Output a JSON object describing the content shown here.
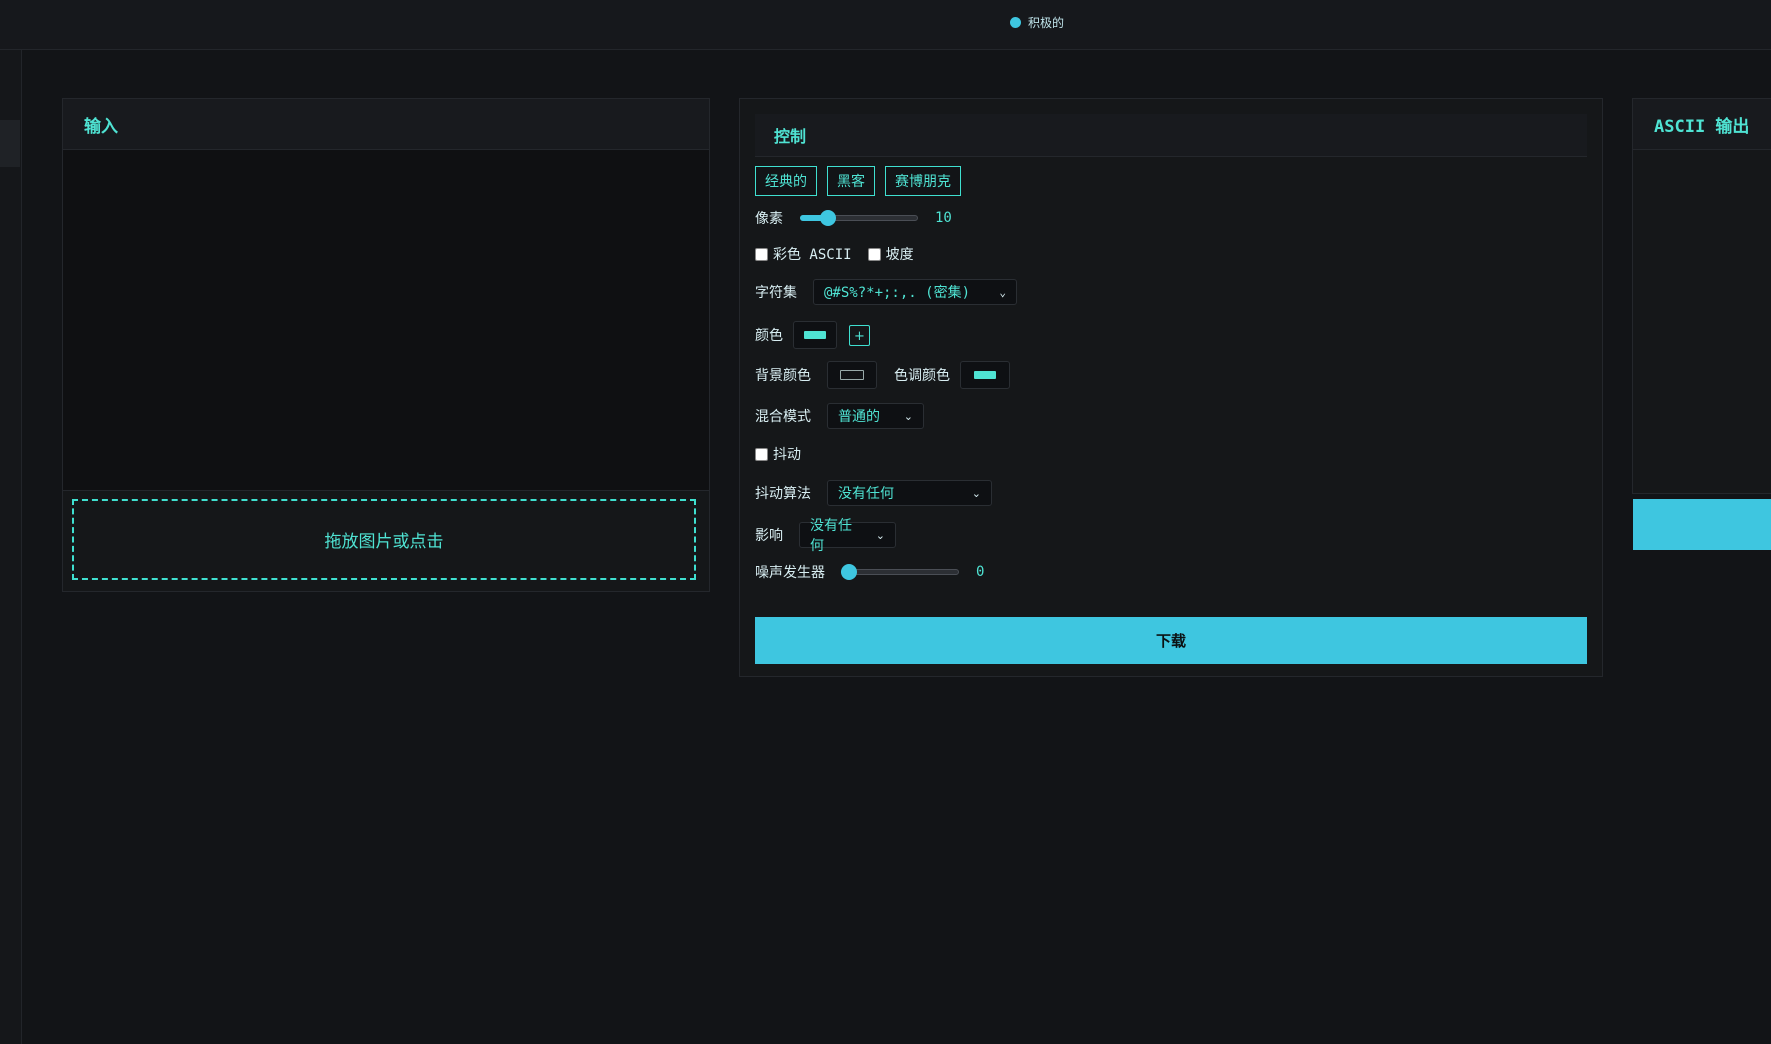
{
  "status": {
    "label": "积极的",
    "dot_color": "#3ec6e0"
  },
  "input_panel": {
    "title": "输入",
    "dropzone_label": "拖放图片或点击"
  },
  "controls": {
    "title": "控制",
    "presets": [
      "经典的",
      "黑客",
      "赛博朋克"
    ],
    "pixel": {
      "label": "像素",
      "value": "10",
      "fraction": 0.24
    },
    "color_ascii_label": "彩色 ASCII",
    "gradient_label": "坡度",
    "charset": {
      "label": "字符集",
      "value": "@#S%?*+;:,. (密集)"
    },
    "color": {
      "label": "颜色",
      "swatch": "#4fe3d3",
      "add": "+"
    },
    "bg_color": {
      "label": "背景颜色",
      "swatch": "#121417"
    },
    "tint_color": {
      "label": "色调颜色",
      "swatch": "#4fe3d3"
    },
    "blend_mode": {
      "label": "混合模式",
      "value": "普通的"
    },
    "dither_label": "抖动",
    "dither_algo": {
      "label": "抖动算法",
      "value": "没有任何"
    },
    "effect": {
      "label": "影响",
      "value": "没有任何"
    },
    "noise": {
      "label": "噪声发生器",
      "value": "0",
      "fraction": 0
    },
    "download_label": "下载"
  },
  "output_panel": {
    "title": "ASCII 输出"
  },
  "accent": "#3ec6e0",
  "text_accent": "#4fe3d3"
}
